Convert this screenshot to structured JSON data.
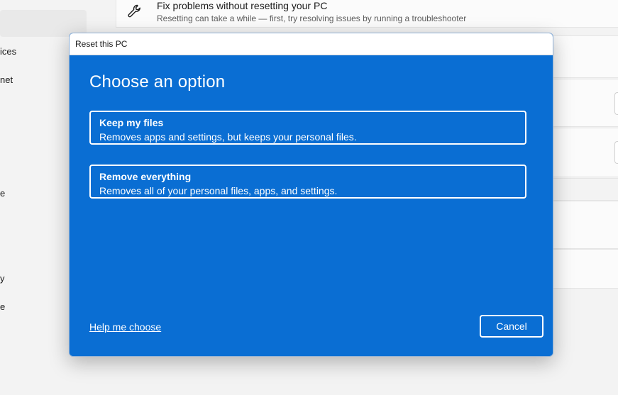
{
  "background": {
    "sidebar_fragments": [
      "ices",
      "net",
      "e",
      "y",
      "e"
    ],
    "recovery_item": {
      "icon": "wrench-icon",
      "title": "Fix problems without resetting your PC",
      "subtitle": "Resetting can take a while — first, try resolving issues by running a troubleshooter"
    }
  },
  "dialog": {
    "title": "Reset this PC",
    "heading": "Choose an option",
    "options": [
      {
        "title": "Keep my files",
        "description": "Removes apps and settings, but keeps your personal files."
      },
      {
        "title": "Remove everything",
        "description": "Removes all of your personal files, apps, and settings."
      }
    ],
    "help_link": "Help me choose",
    "cancel_label": "Cancel"
  },
  "colors": {
    "dialog_blue": "#0a6ed3",
    "text_on_blue": "#ffffff",
    "background": "#f3f3f3"
  }
}
